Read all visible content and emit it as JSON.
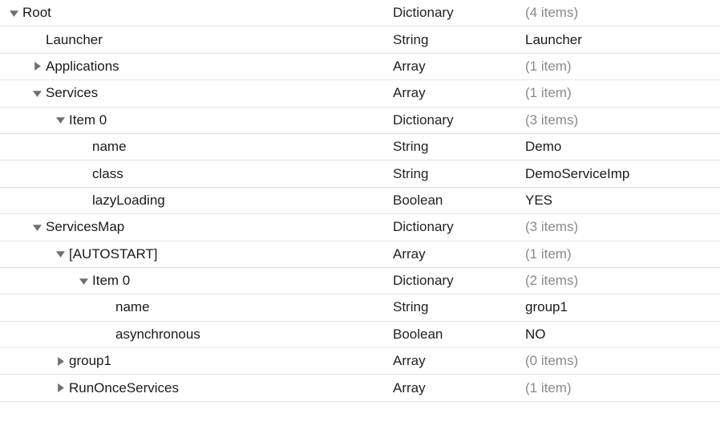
{
  "rows": [
    {
      "indent": 0,
      "arrow": "down",
      "key": "Root",
      "type": "Dictionary",
      "value": "(4 items)",
      "valueIsCount": true
    },
    {
      "indent": 1,
      "arrow": "none",
      "key": "Launcher",
      "type": "String",
      "value": "Launcher",
      "valueIsCount": false
    },
    {
      "indent": 1,
      "arrow": "right",
      "key": "Applications",
      "type": "Array",
      "value": "(1 item)",
      "valueIsCount": true
    },
    {
      "indent": 1,
      "arrow": "down",
      "key": "Services",
      "type": "Array",
      "value": "(1 item)",
      "valueIsCount": true
    },
    {
      "indent": 2,
      "arrow": "down",
      "key": "Item 0",
      "type": "Dictionary",
      "value": "(3 items)",
      "valueIsCount": true
    },
    {
      "indent": 3,
      "arrow": "none",
      "key": "name",
      "type": "String",
      "value": "Demo",
      "valueIsCount": false
    },
    {
      "indent": 3,
      "arrow": "none",
      "key": "class",
      "type": "String",
      "value": "DemoServiceImp",
      "valueIsCount": false
    },
    {
      "indent": 3,
      "arrow": "none",
      "key": "lazyLoading",
      "type": "Boolean",
      "value": "YES",
      "valueIsCount": false
    },
    {
      "indent": 1,
      "arrow": "down",
      "key": "ServicesMap",
      "type": "Dictionary",
      "value": "(3 items)",
      "valueIsCount": true
    },
    {
      "indent": 2,
      "arrow": "down",
      "key": "[AUTOSTART]",
      "type": "Array",
      "value": "(1 item)",
      "valueIsCount": true
    },
    {
      "indent": 3,
      "arrow": "down",
      "key": "Item 0",
      "type": "Dictionary",
      "value": "(2 items)",
      "valueIsCount": true
    },
    {
      "indent": 4,
      "arrow": "none",
      "key": "name",
      "type": "String",
      "value": "group1",
      "valueIsCount": false
    },
    {
      "indent": 4,
      "arrow": "none",
      "key": "asynchronous",
      "type": "Boolean",
      "value": "NO",
      "valueIsCount": false
    },
    {
      "indent": 2,
      "arrow": "right",
      "key": "group1",
      "type": "Array",
      "value": "(0 items)",
      "valueIsCount": true
    },
    {
      "indent": 2,
      "arrow": "right",
      "key": "RunOnceServices",
      "type": "Array",
      "value": "(1 item)",
      "valueIsCount": true
    }
  ],
  "indentStep": 29,
  "leafExtra": 18,
  "triColor": "#6f6f6f"
}
